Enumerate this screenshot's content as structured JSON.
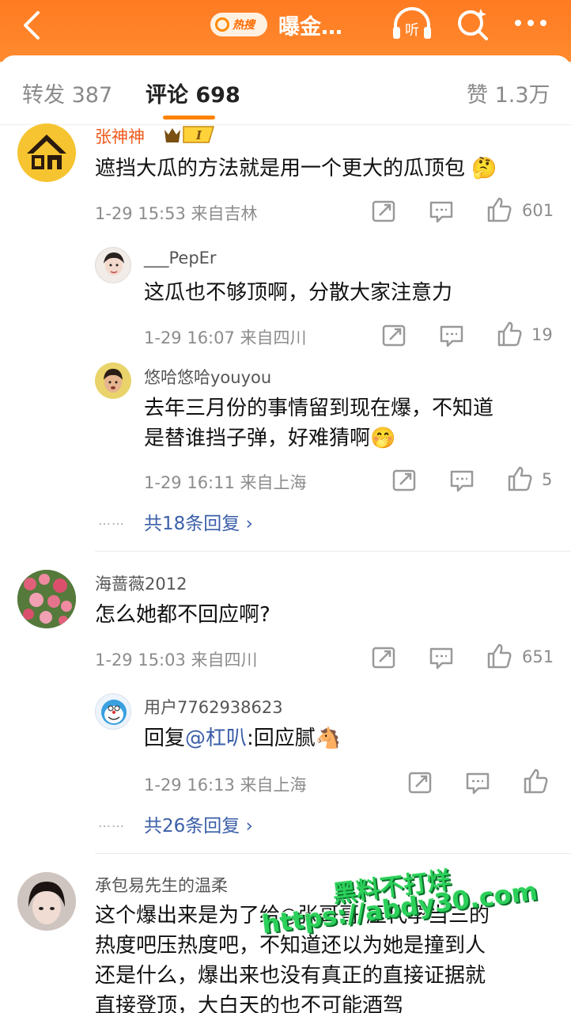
{
  "topbar": {
    "hot_label": "热搜",
    "title": "曝金…",
    "listen_label": "听"
  },
  "tabs": {
    "repost": "转发 387",
    "comments": "评论 698",
    "likes": "赞 1.3万"
  },
  "comments": [
    {
      "user": "张神神",
      "badge": "I",
      "text": "遮挡大瓜的方法就是用一个更大的瓜顶包 🤔",
      "time": "1-29 15:53",
      "location": "来自吉林",
      "likes": "601",
      "replies": [
        {
          "user": "___PepEr",
          "text": "这瓜也不够顶啊，分散大家注意力",
          "time": "1-29 16:07",
          "location": "来自四川",
          "likes": "19"
        },
        {
          "user": "悠哈悠哈youyou",
          "text_lines": [
            "去年三月份的事情留到现在爆，不知道",
            "是替谁挡子弹，好难猜啊🤭"
          ],
          "time": "1-29 16:11",
          "location": "来自上海",
          "likes": "5"
        }
      ],
      "more_replies": "共18条回复 ›"
    },
    {
      "user": "海蔷薇2012",
      "text": "怎么她都不回应啊?",
      "time": "1-29 15:03",
      "location": "来自四川",
      "likes": "651",
      "replies": [
        {
          "user": "用户7762938623",
          "text_prefix": "回复",
          "mention": "@杠叭",
          "text_suffix": ":回应腻🐴",
          "time": "1-29 16:13",
          "location": "来自上海"
        }
      ],
      "more_replies": "共26条回复 ›"
    },
    {
      "user": "承包易先生的温柔",
      "text_lines": [
        "这个爆出来是为了给○张哥哥 压代孕当三的",
        "热度吧压热度吧，不知道还以为她是撞到人",
        "还是什么，爆出来也没有真正的直接证据就",
        "直接登顶，大白天的也不可能酒驾"
      ]
    }
  ],
  "dots": "……",
  "watermark": {
    "line1": "黑料不打烊",
    "line2": "https://abdy30.com"
  },
  "colors": {
    "accent": "#ff8200",
    "link": "#3a5fa8",
    "vip_name": "#f0591a"
  }
}
